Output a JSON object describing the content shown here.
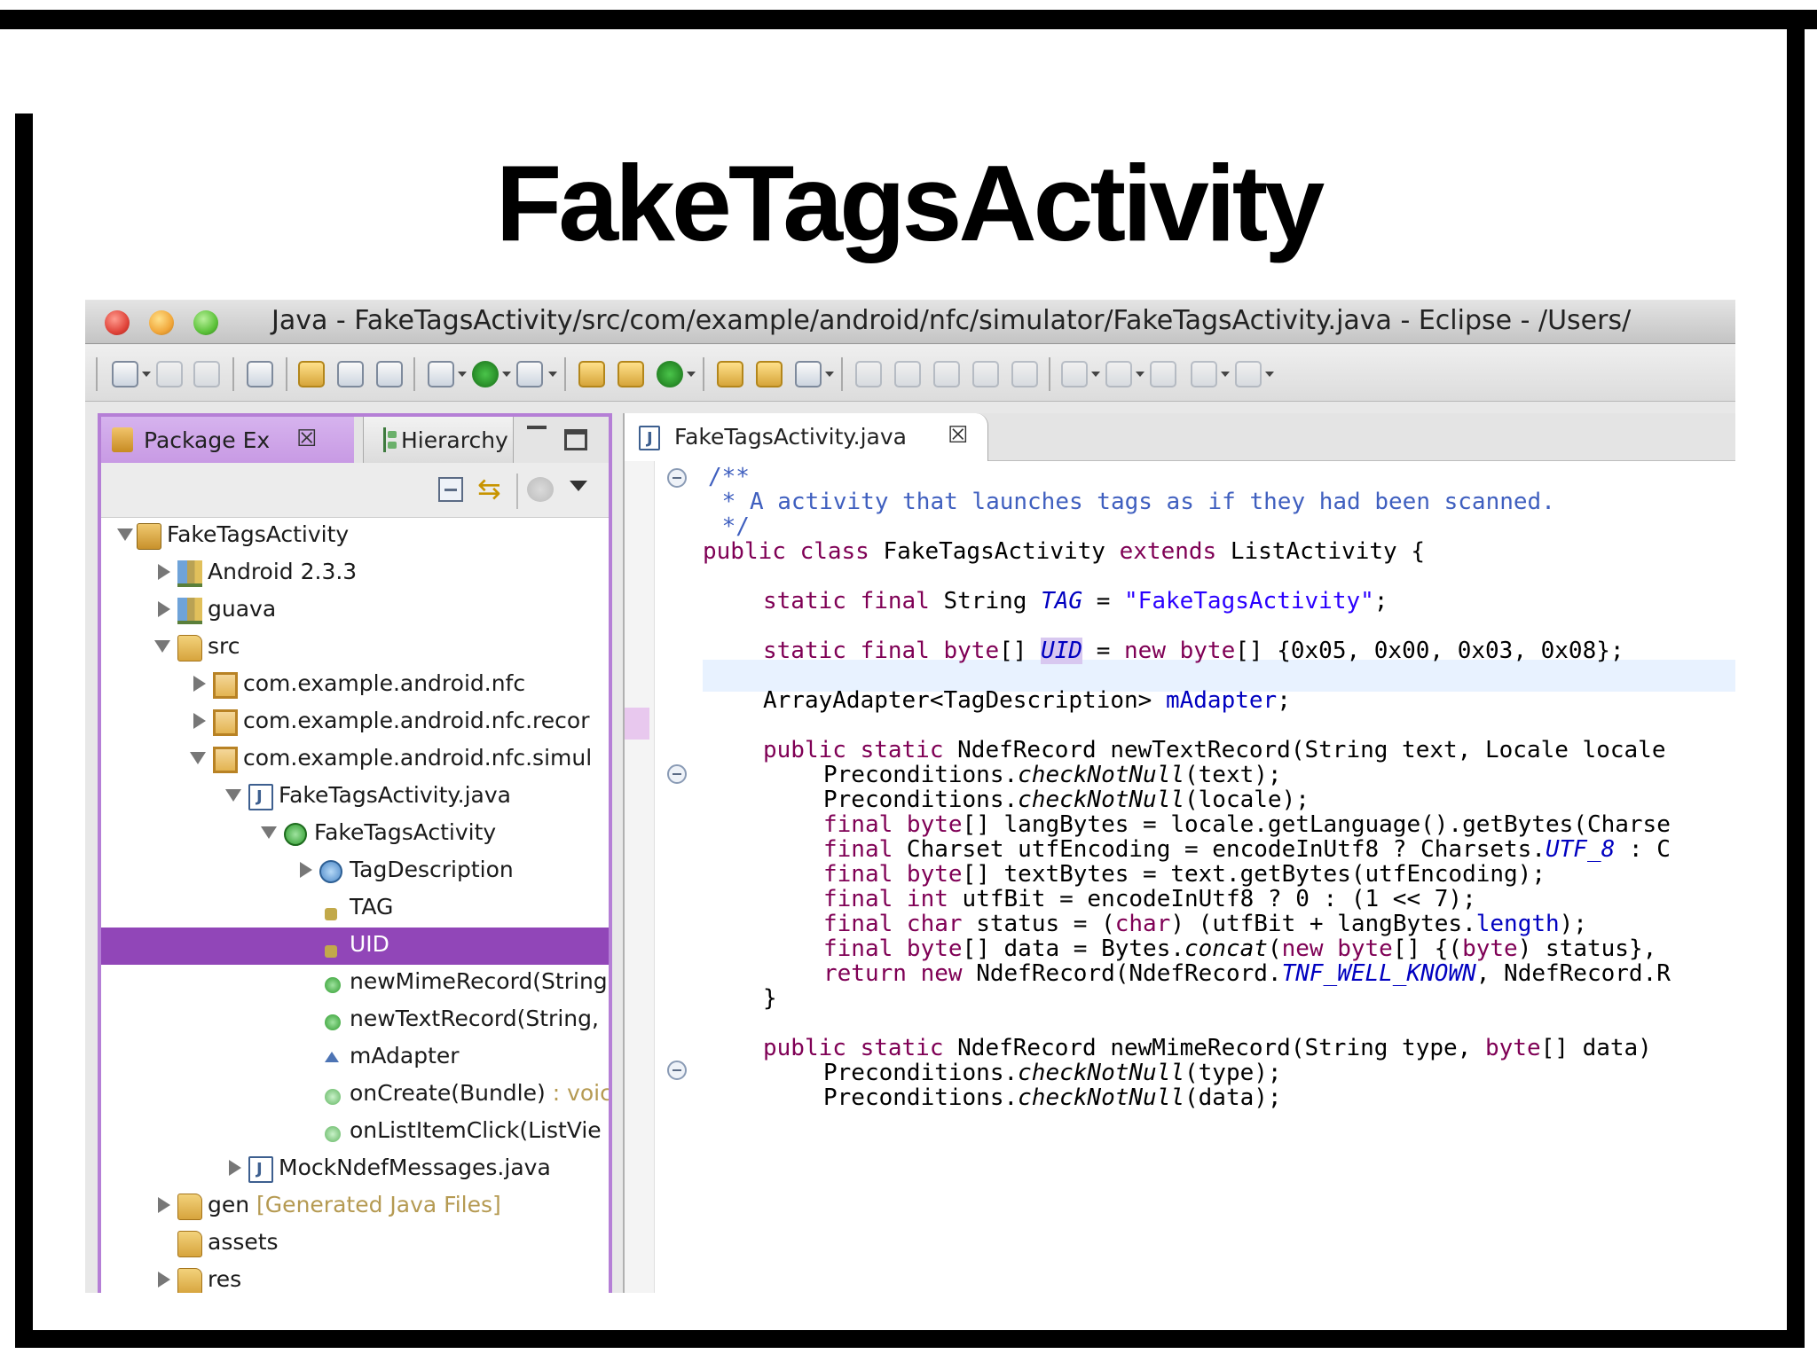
{
  "slide": {
    "title": "FakeTagsActivity"
  },
  "window": {
    "title": "Java - FakeTagsActivity/src/com/example/android/nfc/simulator/FakeTagsActivity.java - Eclipse - /Users/"
  },
  "left_panel": {
    "tabs": [
      {
        "label": "Package Ex",
        "close": "☒",
        "active": true
      },
      {
        "label": "Hierarchy",
        "active": false
      }
    ],
    "tree": [
      {
        "label": "FakeTagsActivity",
        "icon": "project-icon",
        "state": "open"
      },
      {
        "label": "Android 2.3.3",
        "icon": "library-icon",
        "state": "closed"
      },
      {
        "label": "guava",
        "icon": "library-icon",
        "state": "closed"
      },
      {
        "label": "src",
        "icon": "source-folder-icon",
        "state": "open"
      },
      {
        "label": "com.example.android.nfc",
        "icon": "package-icon",
        "state": "closed"
      },
      {
        "label": "com.example.android.nfc.recor",
        "icon": "package-icon",
        "state": "closed"
      },
      {
        "label": "com.example.android.nfc.simul",
        "icon": "package-icon",
        "state": "open"
      },
      {
        "label": "FakeTagsActivity.java",
        "icon": "java-file-icon",
        "state": "open"
      },
      {
        "label": "FakeTagsActivity",
        "icon": "class-icon",
        "state": "open"
      },
      {
        "label": "TagDescription",
        "icon": "inner-class-icon",
        "state": "closed"
      },
      {
        "label": "TAG",
        "icon": "static-field-icon",
        "state": "none"
      },
      {
        "label": "UID",
        "icon": "static-field-icon",
        "state": "none",
        "selected": true
      },
      {
        "label": "newMimeRecord(String",
        "icon": "static-method-icon",
        "state": "none"
      },
      {
        "label": "newTextRecord(String,",
        "icon": "static-method-icon",
        "state": "none"
      },
      {
        "label": "mAdapter",
        "icon": "field-icon",
        "state": "none"
      },
      {
        "label": "onCreate(Bundle)",
        "suffix": " : voic",
        "icon": "method-icon",
        "state": "none"
      },
      {
        "label": "onListItemClick(ListVie",
        "icon": "method-icon",
        "state": "none"
      },
      {
        "label": "MockNdefMessages.java",
        "icon": "java-file-icon",
        "state": "closed"
      },
      {
        "label": "gen",
        "suffix": " [Generated Java Files]",
        "icon": "source-folder-icon",
        "state": "closed"
      },
      {
        "label": "assets",
        "icon": "folder-icon",
        "state": "none"
      },
      {
        "label": "res",
        "icon": "folder-icon",
        "state": "closed"
      }
    ]
  },
  "editor": {
    "tab": {
      "label": "FakeTagsActivity.java",
      "close": "☒"
    },
    "code": {
      "l1": "/**",
      "l2": " * A activity that launches tags as if they had been scanned.",
      "l3": " */",
      "l4_kw1": "public class",
      "l4_name": " FakeTagsActivity ",
      "l4_kw2": "extends",
      "l4_rest": " ListActivity {",
      "l6_kw": "static final",
      "l6_type": " String ",
      "l6_fld": "TAG",
      "l6_eq": " = ",
      "l6_str": "\"FakeTagsActivity\"",
      "l6_end": ";",
      "l8_kw": "static final byte",
      "l8_arr": "[] ",
      "l8_fld": "UID",
      "l8_eq": " = ",
      "l8_kw2": "new byte",
      "l8_rest": "[] {0x05, 0x00, 0x03, 0x08};",
      "l10_type": "ArrayAdapter<TagDescription> ",
      "l10_fld": "mAdapter",
      "l10_end": ";",
      "l12_kw": "public static",
      "l12_rest": " NdefRecord newTextRecord(String text, Locale locale",
      "l13_a": "Preconditions.",
      "l13_b": "checkNotNull",
      "l13_c": "(text);",
      "l14_a": "Preconditions.",
      "l14_b": "checkNotNull",
      "l14_c": "(locale);",
      "l15_kw": "final byte",
      "l15_rest": "[] langBytes = locale.getLanguage().getBytes(Charse",
      "l16_kw": "final",
      "l16_a": " Charset utfEncoding = encodeInUtf8 ? Charsets.",
      "l16_fld": "UTF_8",
      "l16_b": " : C",
      "l17_kw": "final byte",
      "l17_rest": "[] textBytes = text.getBytes(utfEncoding);",
      "l18_kw": "final int",
      "l18_rest": " utfBit = encodeInUtf8 ? 0 : (1 << 7);",
      "l19_kw": "final char",
      "l19_a": " status = (",
      "l19_kw2": "char",
      "l19_b": ") (utfBit + langBytes.",
      "l19_fld": "length",
      "l19_c": ");",
      "l20_kw": "final byte",
      "l20_a": "[] data = Bytes.",
      "l20_it": "concat",
      "l20_b": "(",
      "l20_kw2": "new byte",
      "l20_c": "[] {(",
      "l20_kw3": "byte",
      "l20_d": ") status},",
      "l21_kw": "return new",
      "l21_a": " NdefRecord(NdefRecord.",
      "l21_fld": "TNF_WELL_KNOWN",
      "l21_b": ", NdefRecord.R",
      "l22": "}",
      "l24_kw": "public static",
      "l24_a": " NdefRecord newMimeRecord(String type, ",
      "l24_kw2": "byte",
      "l24_b": "[] data)",
      "l25_a": "Preconditions.",
      "l25_b": "checkNotNull",
      "l25_c": "(type);",
      "l26_a": "Preconditions.",
      "l26_b": "checkNotNull",
      "l26_c": "(data);"
    }
  }
}
